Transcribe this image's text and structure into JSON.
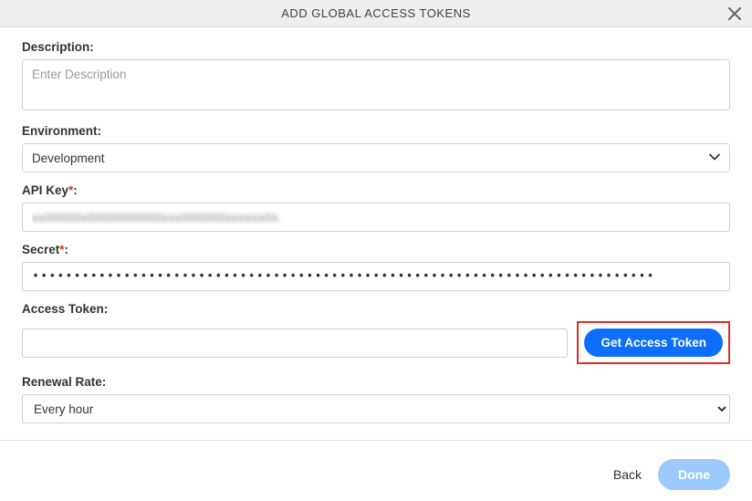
{
  "header": {
    "title": "ADD GLOBAL ACCESS TOKENS"
  },
  "form": {
    "description": {
      "label": "Description:",
      "placeholder": "Enter Description",
      "value": ""
    },
    "environment": {
      "label": "Environment:",
      "value": "Development"
    },
    "apiKey": {
      "label": "API Key",
      "required": "*",
      "colon": ":",
      "value": "xx00000x0000000000xxx000000xxxxxx0x"
    },
    "secret": {
      "label": "Secret",
      "required": "*",
      "colon": ":",
      "value": "•••••••••••••••••••••••••••••••••••••••••••••••••••••••••••••••••••••••••••"
    },
    "accessToken": {
      "label": "Access Token:",
      "value": "",
      "buttonLabel": "Get Access Token"
    },
    "renewalRate": {
      "label": "Renewal Rate:",
      "value": "Every hour"
    }
  },
  "footer": {
    "back": "Back",
    "done": "Done"
  }
}
